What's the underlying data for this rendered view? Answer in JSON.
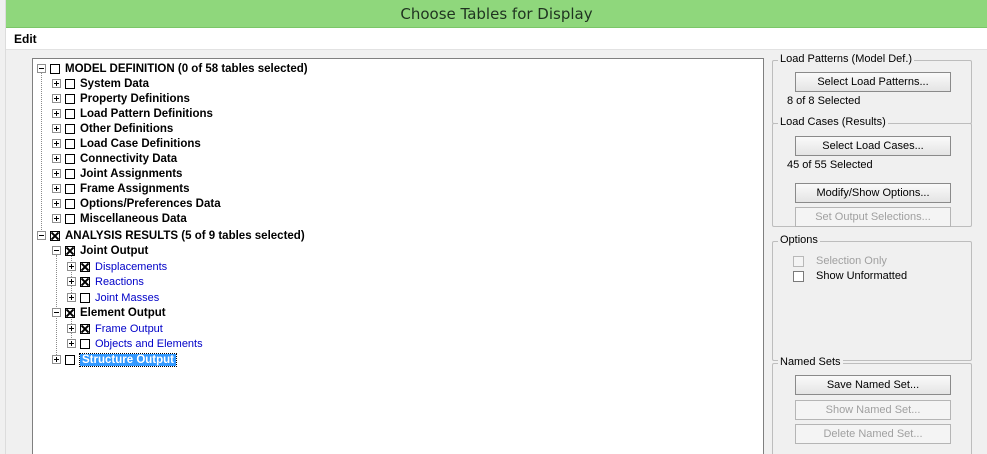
{
  "window": {
    "title": "Choose Tables for Display"
  },
  "menu": {
    "edit_label": "Edit"
  },
  "tree": {
    "model_definition": "MODEL DEFINITION  (0 of 58 tables selected)",
    "model_children": [
      "System Data",
      "Property Definitions",
      "Load Pattern Definitions",
      "Other Definitions",
      "Load Case Definitions",
      "Connectivity Data",
      "Joint Assignments",
      "Frame Assignments",
      "Options/Preferences Data",
      "Miscellaneous Data"
    ],
    "analysis_results": "ANALYSIS RESULTS  (5 of 9 tables selected)",
    "joint_output": "Joint Output",
    "joint_children": [
      "Displacements",
      "Reactions",
      "Joint Masses"
    ],
    "element_output": "Element Output",
    "element_children": [
      "Frame Output",
      "Objects and Elements"
    ],
    "structure_output": "Structure Output"
  },
  "load_patterns": {
    "title": "Load Patterns (Model Def.)",
    "button": "Select Load Patterns...",
    "status": "8 of 8 Selected"
  },
  "load_cases": {
    "title": "Load Cases (Results)",
    "button": "Select Load Cases...",
    "status": "45 of 55 Selected",
    "modify_button": "Modify/Show Options...",
    "output_button": "Set Output Selections..."
  },
  "options": {
    "title": "Options",
    "selection_only": "Selection Only",
    "show_unformatted": "Show Unformatted"
  },
  "named_sets": {
    "title": "Named Sets",
    "save_button": "Save Named Set...",
    "show_button": "Show Named Set...",
    "delete_button": "Delete Named Set..."
  }
}
